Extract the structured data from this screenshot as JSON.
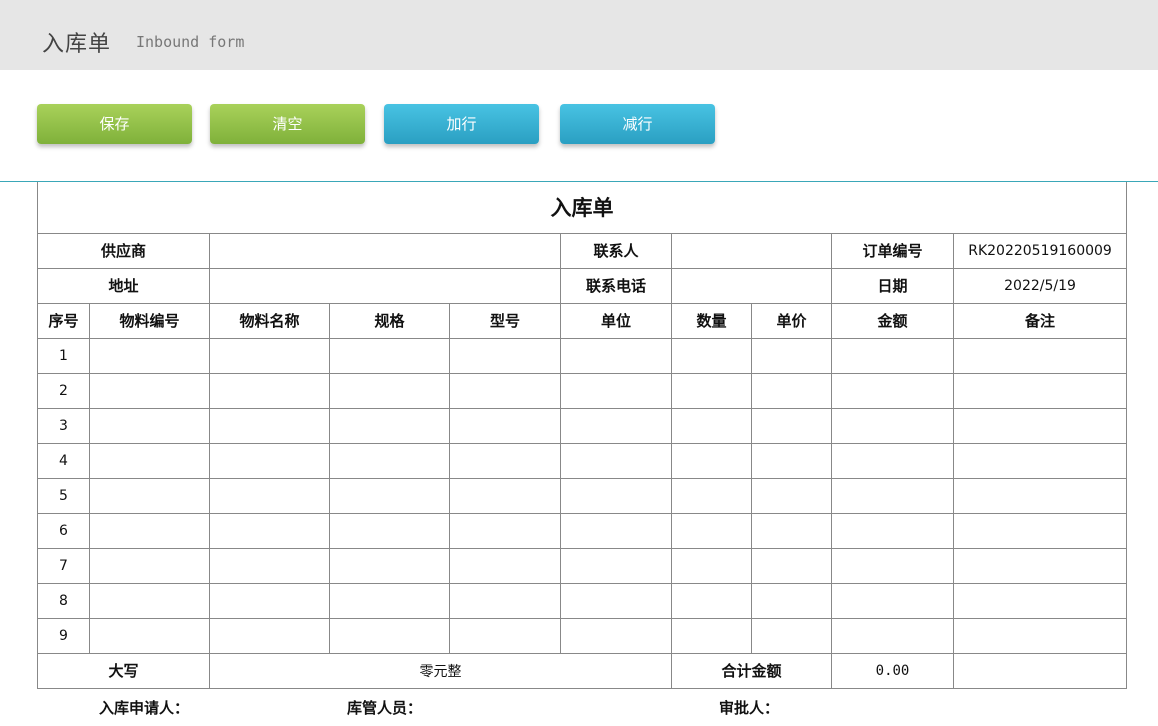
{
  "header": {
    "title": "入库单",
    "subtitle": "Inbound form"
  },
  "toolbar": {
    "save_label": "保存",
    "clear_label": "清空",
    "add_row_label": "加行",
    "remove_row_label": "减行"
  },
  "form": {
    "title": "入库单",
    "supplier_label": "供应商",
    "supplier_value": "",
    "contact_label": "联系人",
    "contact_value": "",
    "order_no_label": "订单编号",
    "order_no_value": "RK20220519160009",
    "address_label": "地址",
    "address_value": "",
    "phone_label": "联系电话",
    "phone_value": "",
    "date_label": "日期",
    "date_value": "2022/5/19",
    "columns": [
      "序号",
      "物料编号",
      "物料名称",
      "规格",
      "型号",
      "单位",
      "数量",
      "单价",
      "金额",
      "备注"
    ],
    "rows": [
      "1",
      "2",
      "3",
      "4",
      "5",
      "6",
      "7",
      "8",
      "9"
    ],
    "uppercase_label": "大写",
    "uppercase_value": "零元整",
    "total_label": "合计金额",
    "total_value": "0.00"
  },
  "signatures": {
    "applicant_label": "入库申请人：",
    "keeper_label": "库管人员：",
    "approver_label": "审批人："
  }
}
